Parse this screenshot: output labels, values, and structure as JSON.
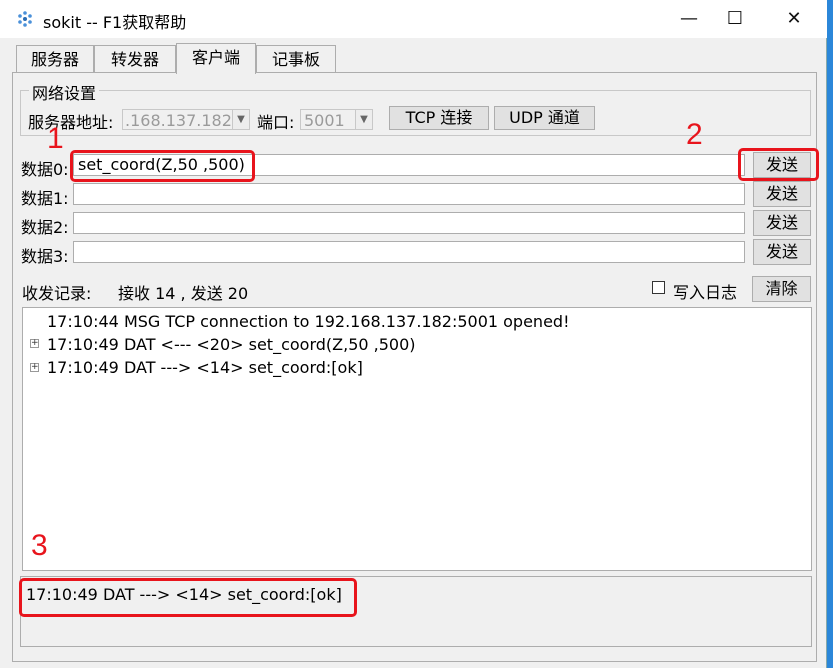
{
  "window": {
    "title": "sokit -- F1获取帮助",
    "minimize": "—",
    "maximize": "☐",
    "close": "✕"
  },
  "tabs": [
    {
      "label": "服务器"
    },
    {
      "label": "转发器"
    },
    {
      "label": "客户端"
    },
    {
      "label": "记事板"
    }
  ],
  "network": {
    "group_title": "网络设置",
    "server_addr_label": "服务器地址:",
    "server_addr_value": ".168.137.182",
    "port_label": "端口:",
    "port_value": "5001",
    "tcp_button": "TCP 连接",
    "udp_button": "UDP 通道"
  },
  "data_rows": [
    {
      "label": "数据0:",
      "value": "set_coord(Z,50 ,500)",
      "send": "发送"
    },
    {
      "label": "数据1:",
      "value": "",
      "send": "发送"
    },
    {
      "label": "数据2:",
      "value": "",
      "send": "发送"
    },
    {
      "label": "数据3:",
      "value": "",
      "send": "发送"
    }
  ],
  "record": {
    "label": "收发记录:",
    "stats": "接收 14 , 发送 20",
    "log_checkbox_label": "写入日志",
    "clear_button": "清除"
  },
  "log": [
    {
      "text": "17:10:44 MSG TCP connection to 192.168.137.182:5001 opened!",
      "expandable": false
    },
    {
      "text": "17:10:49 DAT <--- <20> set_coord(Z,50 ,500)",
      "expandable": true
    },
    {
      "text": "17:10:49 DAT ---> <14> set_coord:[ok]",
      "expandable": true
    }
  ],
  "detail": {
    "text": "17:10:49 DAT ---> <14> set_coord:[ok]"
  },
  "annotations": {
    "n1": "1",
    "n2": "2",
    "n3": "3",
    "color": "#e8141c"
  },
  "icons": {
    "app": "gear-dots-icon",
    "expand": "plus-box-icon"
  }
}
